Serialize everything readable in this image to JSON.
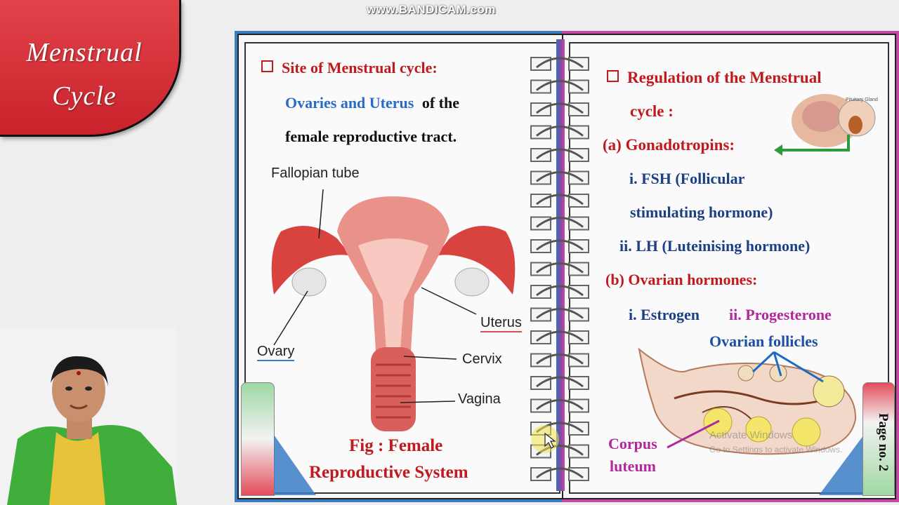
{
  "watermark": "www.BANDICAM.com",
  "title": {
    "line1": "Menstrual",
    "line2": "Cycle"
  },
  "left_page": {
    "heading": "Site of Menstrual cycle:",
    "site_highlight": "Ovaries and Uterus",
    "site_rest": "of the",
    "site_line2": "female reproductive  tract.",
    "diagram_labels": {
      "fallopian_tube": "Fallopian tube",
      "uterus": "Uterus",
      "ovary": "Ovary",
      "cervix": "Cervix",
      "vagina": "Vagina"
    },
    "caption_line1": "Fig : Female",
    "caption_line2": "Reproductive System"
  },
  "right_page": {
    "heading_line1": "Regulation of the Menstrual",
    "heading_line2": "cycle :",
    "a_label": "(a)  Gonadotropins:",
    "fsh_line1": "i. FSH  (Follicular",
    "fsh_line2": "stimulating hormone)",
    "lh": "ii. LH (Luteinising hormone)",
    "b_label": "(b) Ovarian hormones:",
    "estrogen": "i. Estrogen",
    "progesterone": "ii. Progesterone",
    "ovarian_follicles": "Ovarian follicles",
    "corpus_line1": "Corpus",
    "corpus_line2": "luteum",
    "pituitary_label": "Pituitary Gland",
    "activate_line1": "Activate Windows",
    "activate_line2": "Go to Settings to activate Windows."
  },
  "page_number": "Page no. 2",
  "colors": {
    "title_red": "#c9222b",
    "heading_red": "#c0191e",
    "highlight_blue": "#2a6cc5",
    "hormone_navy": "#1c3f86",
    "progesterone_purple": "#b0289c",
    "book_left_border": "#3b7dc4",
    "book_right_border": "#c24aa0"
  }
}
